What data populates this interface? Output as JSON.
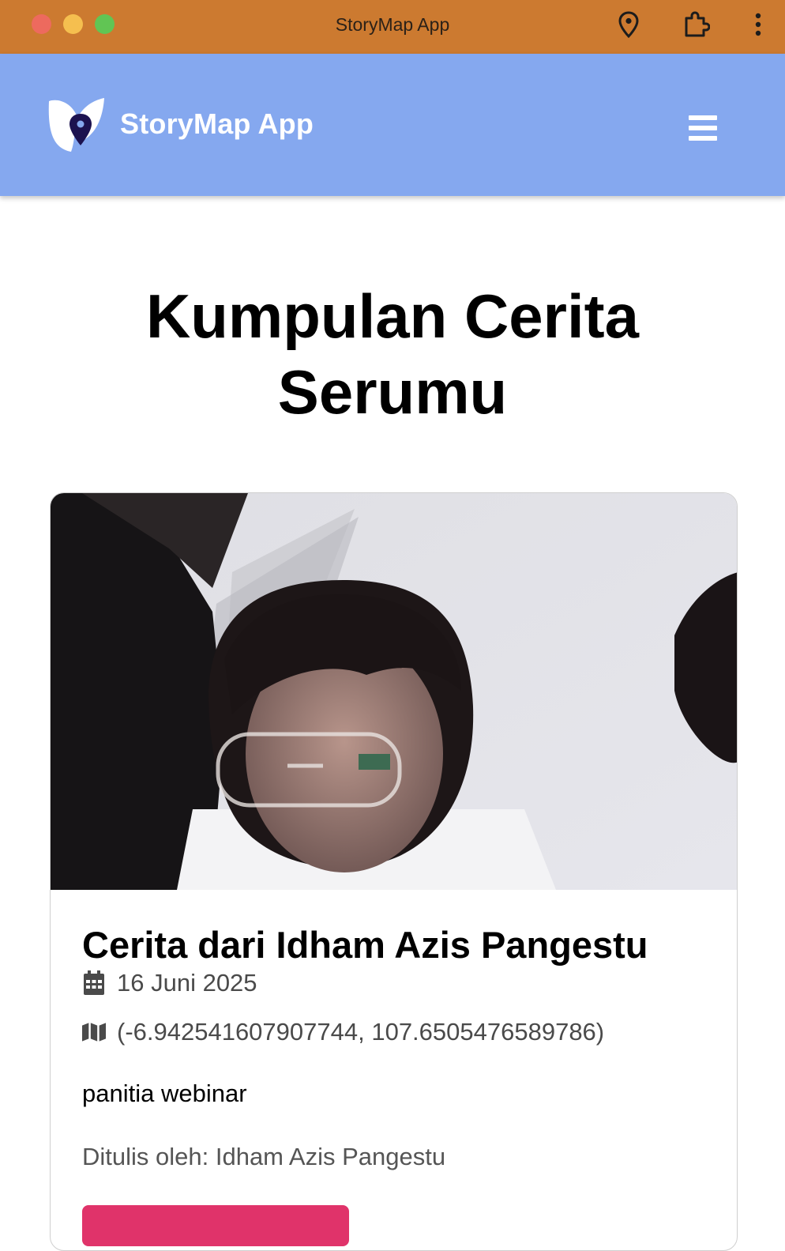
{
  "window": {
    "title": "StoryMap App",
    "traffic_lights": [
      "close",
      "minimize",
      "maximize"
    ],
    "toolbar_icons": [
      "location-pin-icon",
      "extension-icon",
      "more-vertical-icon"
    ],
    "colors": {
      "titlebar": "#cc7a30"
    }
  },
  "header": {
    "brand": "StoryMap App",
    "logo": "butterfly-location-pin-logo",
    "menu_icon": "hamburger-menu-icon",
    "colors": {
      "background": "#85a8ef",
      "text": "#ffffff"
    }
  },
  "main": {
    "title": "Kumpulan Cerita Serumu",
    "stories": [
      {
        "photo": "selfie-photo",
        "title": "Cerita dari Idham Azis Pangestu",
        "date_icon": "calendar-icon",
        "date": "16 Juni 2025",
        "location_icon": "map-icon",
        "location": "(-6.942541607907744, 107.6505476589786)",
        "description": "panitia webinar",
        "author": "Ditulis oleh: Idham Azis Pangestu",
        "button_color": "#e0336a"
      }
    ]
  }
}
